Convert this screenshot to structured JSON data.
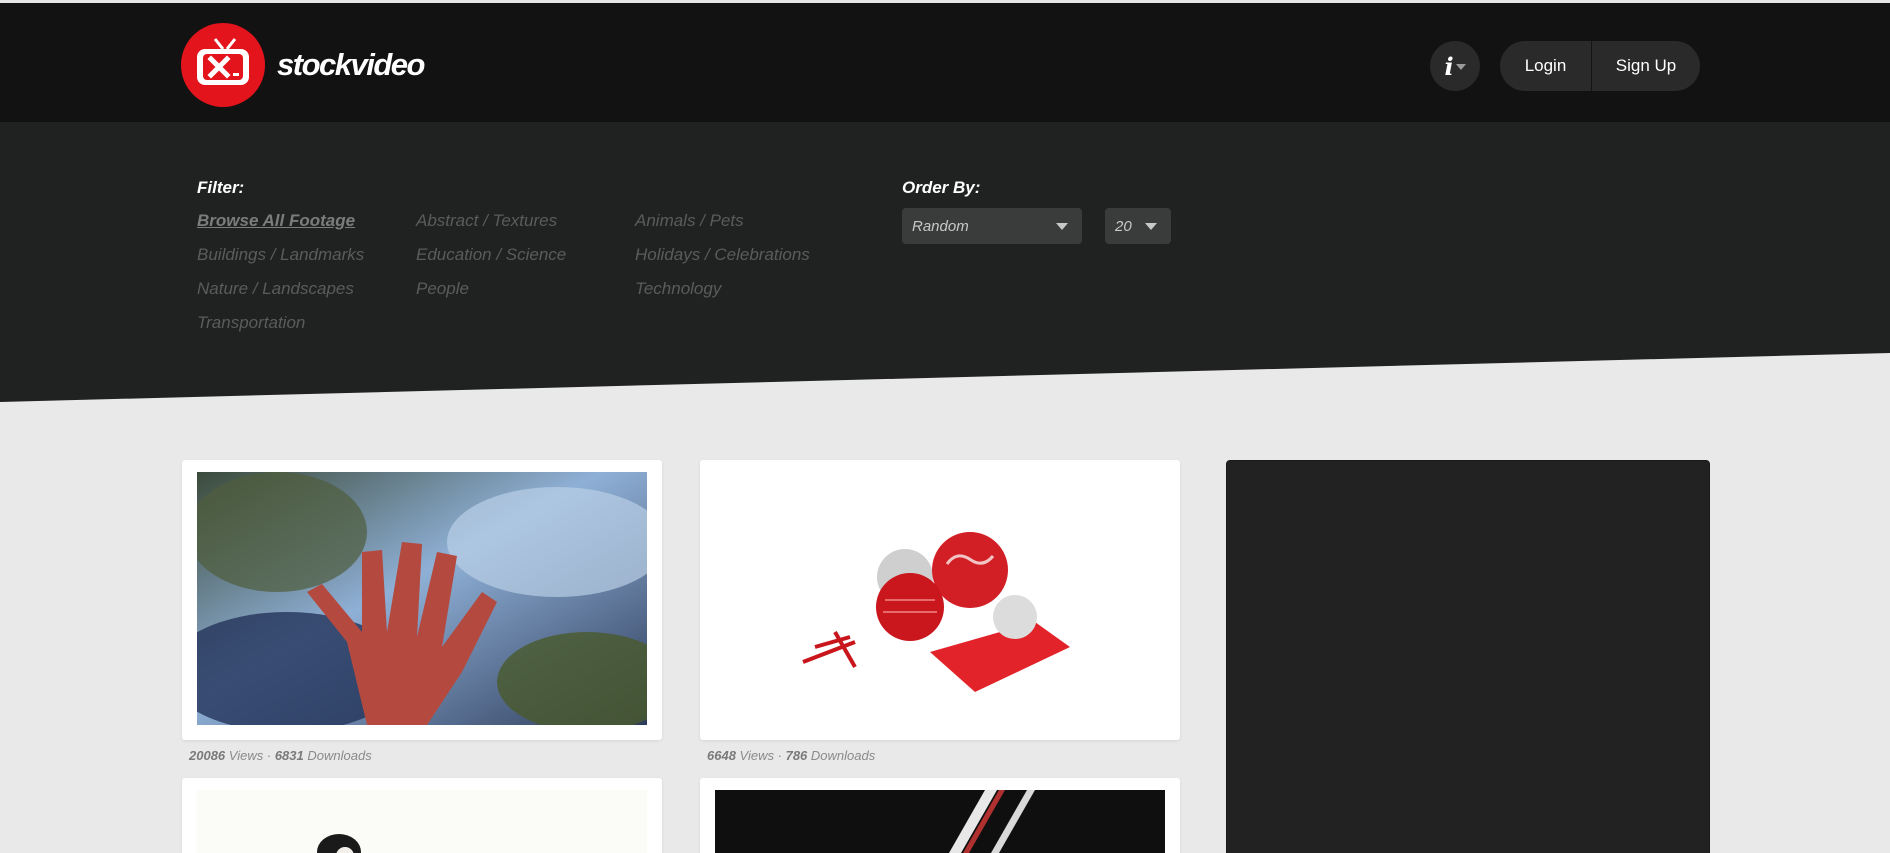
{
  "brand": {
    "name": "stockvideo",
    "logo_color": "#e3141c"
  },
  "header": {
    "login_label": "Login",
    "signup_label": "Sign Up",
    "info_icon": "info-icon"
  },
  "filter": {
    "title": "Filter:",
    "categories": [
      {
        "label": "Browse All Footage",
        "active": true
      },
      {
        "label": "Abstract / Textures"
      },
      {
        "label": "Animals / Pets"
      },
      {
        "label": "Buildings / Landmarks"
      },
      {
        "label": "Education / Science"
      },
      {
        "label": "Holidays / Celebrations"
      },
      {
        "label": "Nature / Landscapes"
      },
      {
        "label": "People"
      },
      {
        "label": "Technology"
      },
      {
        "label": "Transportation"
      }
    ]
  },
  "order": {
    "title": "Order By:",
    "selected": "Random",
    "per_page": "20"
  },
  "videos": [
    {
      "views": "20086",
      "views_label": "Views",
      "sep": "·",
      "downloads": "6831",
      "downloads_label": "Downloads"
    },
    {
      "views": "6648",
      "views_label": "Views",
      "sep": "·",
      "downloads": "786",
      "downloads_label": "Downloads"
    }
  ]
}
